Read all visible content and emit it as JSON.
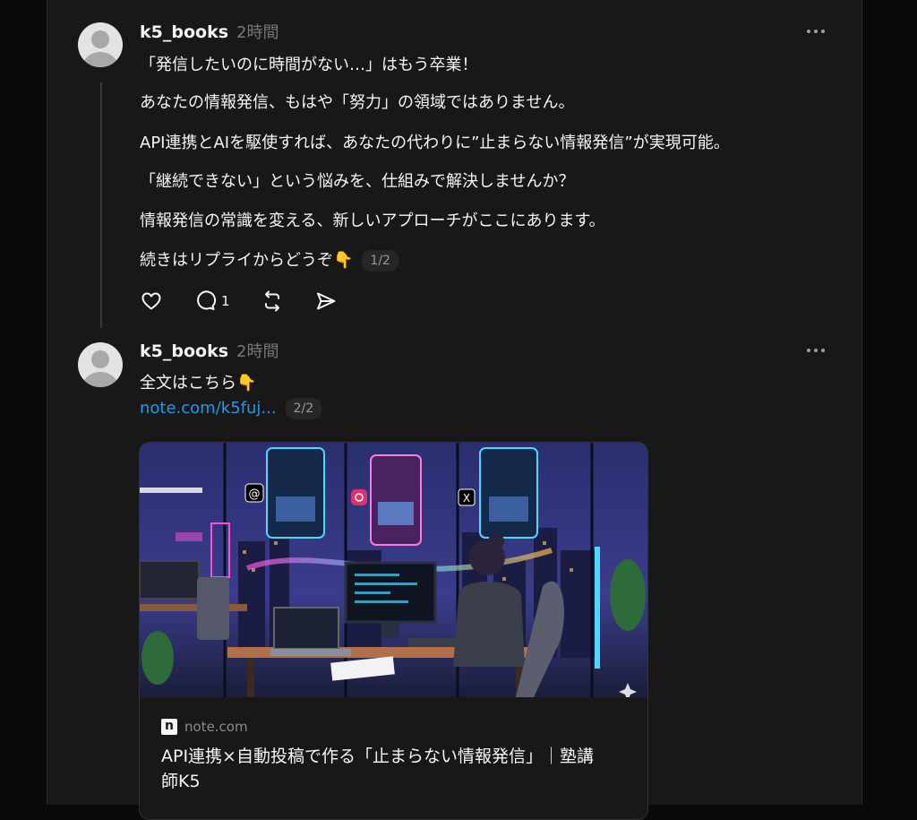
{
  "posts": [
    {
      "username": "k5_books",
      "time": "2時間",
      "lines": [
        "「発信したいのに時間がない…」はもう卒業！",
        "あなたの情報発信、もはや「努力」の領域ではありません。",
        "API連携とAIを駆使すれば、あなたの代わりに”止まらない情報発信”が実現可能。",
        "「継続できない」という悩みを、仕組みで解決しませんか？",
        "情報発信の常識を変える、新しいアプローチがここにあります。",
        "続きはリプライからどうぞ👇"
      ],
      "counter": "1/2",
      "actions": {
        "like_icon": "heart-icon",
        "reply_icon": "comment-icon",
        "reply_count": "1",
        "repost_icon": "repost-icon",
        "share_icon": "send-icon"
      }
    },
    {
      "username": "k5_books",
      "time": "2時間",
      "text": "全文はこちら👇",
      "link": "note.com/k5fuj...",
      "counter": "2/2",
      "card": {
        "domain": "note.com",
        "title": "API連携×自動投稿で作る「止まらない情報発信」｜塾講師K5",
        "image_description_icons": [
          "threads-icon",
          "instagram-icon",
          "x-icon"
        ]
      }
    }
  ],
  "colors": {
    "background": "#0a0a0a",
    "column": "#181818",
    "text": "#f3f5f7",
    "muted": "#777777",
    "link": "#1d9bf0"
  }
}
